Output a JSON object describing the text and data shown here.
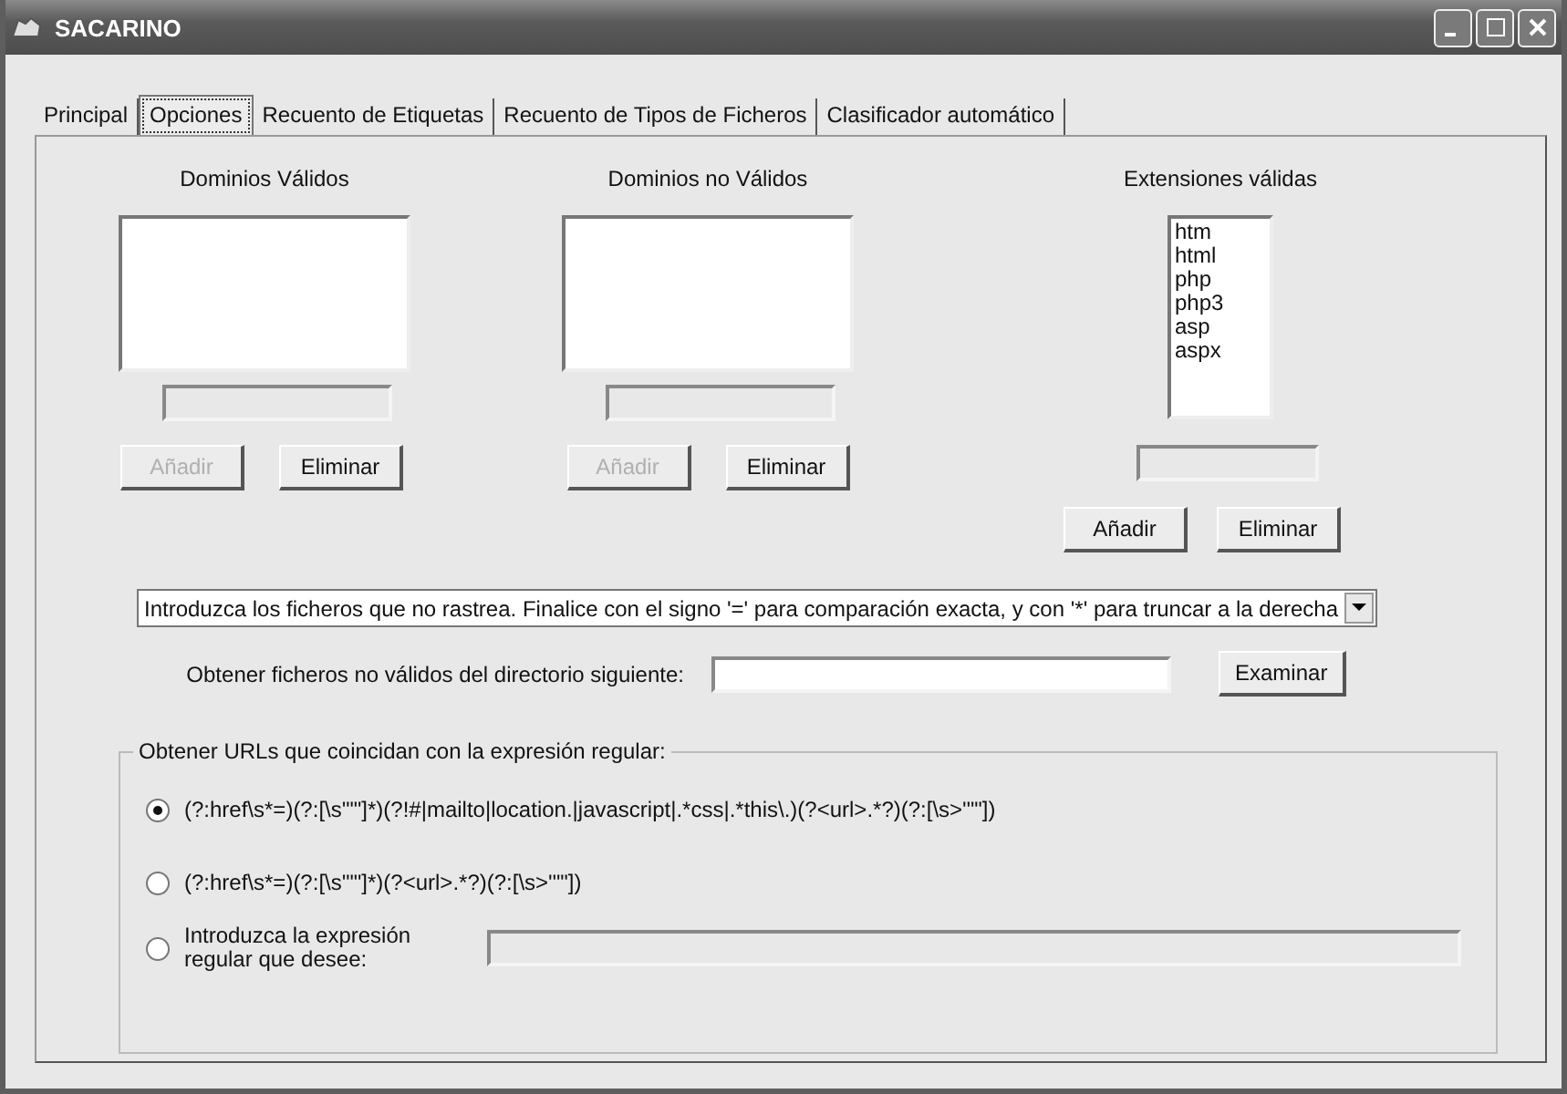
{
  "window": {
    "title": "SACARINO"
  },
  "tabs": [
    {
      "label": "Principal",
      "selected": false
    },
    {
      "label": "Opciones",
      "selected": true
    },
    {
      "label": "Recuento de Etiquetas",
      "selected": false
    },
    {
      "label": "Recuento de Tipos de Ficheros",
      "selected": false
    },
    {
      "label": "Clasificador automático",
      "selected": false
    }
  ],
  "lists": [
    {
      "title": "Dominios Válidos",
      "buttons": [
        {
          "label": "Añadir",
          "disabled": true
        },
        {
          "label": "Eliminar",
          "disabled": false
        }
      ]
    },
    {
      "title": "Dominios no Válidos",
      "buttons": [
        {
          "label": "Añadir",
          "disabled": true
        },
        {
          "label": "Eliminar",
          "disabled": false
        }
      ]
    },
    {
      "title": "Extensiones válidas",
      "items": [
        "htm",
        "html",
        "php",
        "php3",
        "asp",
        "aspx"
      ],
      "buttons": [
        {
          "label": "Añadir",
          "disabled": false
        },
        {
          "label": "Eliminar",
          "disabled": false
        }
      ]
    }
  ],
  "excluded_files": {
    "value": "Introduzca los ficheros que no rastrea. Finalice con el signo '=' para comparación exacta, y con '*' para truncar a la derecha"
  },
  "directory": {
    "label": "Obtener ficheros no válidos del directorio siguiente:",
    "button": "Examinar"
  },
  "regex_group": {
    "title": "Obtener URLs que coincidan con la expresión regular:",
    "options": [
      {
        "label": "(?:href\\s*=)(?:[\\s'\"\"]*)(?!#|mailto|location.|javascript|.*css|.*this\\.)(?<url>.*?)(?:[\\s>'\"\"])",
        "selected": true,
        "kind": "text"
      },
      {
        "label": "(?:href\\s*=)(?:[\\s'\"\"]*)(?<url>.*?)(?:[\\s>'\"\"])",
        "selected": false,
        "kind": "text"
      },
      {
        "label": "Introduzca la expresión regular que desee:",
        "selected": false,
        "kind": "input"
      }
    ]
  }
}
